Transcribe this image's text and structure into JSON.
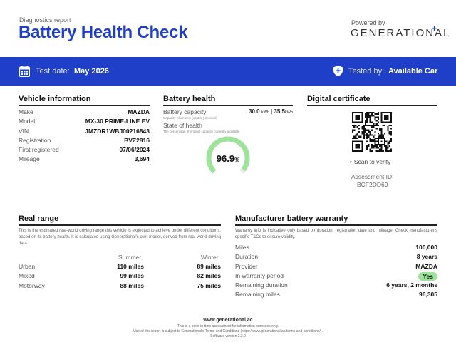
{
  "header": {
    "subtitle": "Diagnostics report",
    "title": "Battery Health Check",
    "powered_by": "Powered by",
    "brand": "GENERATIONAL",
    "brand_plus": "+"
  },
  "band": {
    "test_date_label": "Test date:",
    "test_date_value": "May 2026",
    "tested_by_label": "Tested by:",
    "tested_by_value": "Available Car",
    "calendar_icon": "calendar-icon",
    "shield_icon": "shield-plus-icon",
    "color": "#1f3fc8"
  },
  "vehicle": {
    "title": "Vehicle information",
    "rows": [
      {
        "label": "Make",
        "value": "MAZDA"
      },
      {
        "label": "Model",
        "value": "MX-30 PRIME-LINE EV"
      },
      {
        "label": "VIN",
        "value": "JMZDR1WBJ00216843"
      },
      {
        "label": "Registration",
        "value": "BVZ2816"
      },
      {
        "label": "First registered",
        "value": "07/06/2024"
      },
      {
        "label": "Mileage",
        "value": "3,694"
      }
    ]
  },
  "battery": {
    "title": "Battery health",
    "capacity_label": "Battery capacity",
    "capacity_usable": "30.0",
    "capacity_unit_1": "kWh",
    "capacity_sep": "|",
    "capacity_nominal": "35.5",
    "capacity_unit_2": "kWh",
    "capacity_sub": "Capacity when new (usable | nominal)",
    "soh_label": "State of health",
    "soh_sub": "The percentage of original capacity currently available",
    "soh_value": "96.9",
    "soh_unit": "%",
    "soh_fraction": 0.969,
    "gauge_color": "#9ee39a",
    "gauge_track_color": "#e6e6e6"
  },
  "certificate": {
    "title": "Digital certificate",
    "scan_label": "Scan to verify",
    "scan_icon": "qr-scan-icon",
    "assessment_label": "Assessment ID",
    "assessment_id": "BCF2DD69"
  },
  "range": {
    "title": "Real range",
    "description": "This is the estimated real-world driving range this vehicle is expected to achieve under different conditions, based on its battery health. It is calculated using Generational's own model, derived from real-world driving data.",
    "summer_label": "Summer",
    "winter_label": "Winter",
    "rows": [
      {
        "label": "Urban",
        "summer": "110 miles",
        "winter": "89 miles"
      },
      {
        "label": "Mixed",
        "summer": "99 miles",
        "winter": "82 miles"
      },
      {
        "label": "Motorway",
        "summer": "88 miles",
        "winter": "75 miles"
      }
    ]
  },
  "warranty": {
    "title": "Manufacturer battery warranty",
    "description": "Warranty info is indicative only based on duration, registration date and mileage. Check manufacturer's specific T&Cs to ensure validity.",
    "rows": [
      {
        "label": "Miles",
        "value": "100,000"
      },
      {
        "label": "Duration",
        "value": "8 years"
      },
      {
        "label": "Provider",
        "value": "MAZDA"
      },
      {
        "label": "In warranty period",
        "value": "Yes"
      },
      {
        "label": "Remaining duration",
        "value": "6 years, 2 months"
      },
      {
        "label": "Remaining miles",
        "value": "96,305"
      }
    ]
  },
  "footer": {
    "url": "www.generational.ac",
    "line1": "This is a point-in-time assessment for information purposes only.",
    "line2": "Use of this report is subject to Generational's Terms and Conditions (https://www.generational.ac/terms-and-conditions/).",
    "line3": "Software version 2.2.0"
  }
}
